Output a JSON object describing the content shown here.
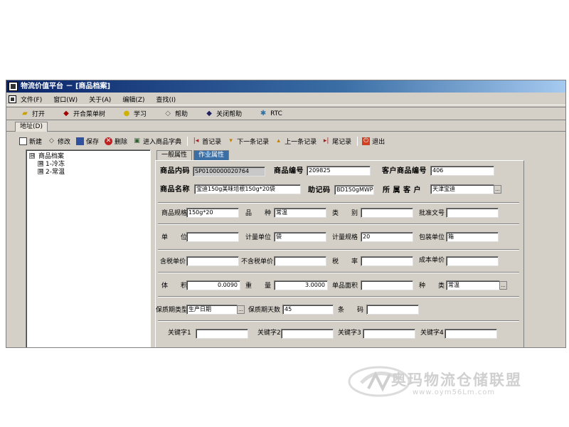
{
  "window": {
    "title": "物流价值平台 － [商品档案]"
  },
  "menu": [
    "文件(F)",
    "窗口(W)",
    "关于(A)",
    "编辑(Z)",
    "查找(I)"
  ],
  "toolbar": [
    {
      "label": "打开",
      "icon": "folder-open-icon"
    },
    {
      "label": "开合菜单树",
      "icon": "car-icon"
    },
    {
      "label": "学习",
      "icon": "bulb-icon"
    },
    {
      "label": "帮助",
      "icon": "diamond-icon"
    },
    {
      "label": "关闭帮助",
      "icon": "diamond-dark-icon"
    },
    {
      "label": "RTC",
      "icon": "gear-icon"
    }
  ],
  "address": {
    "label": "地址(D)"
  },
  "actions": [
    {
      "label": "新建",
      "icon": "new-doc-icon"
    },
    {
      "label": "修改",
      "icon": "edit-icon"
    },
    {
      "label": "保存",
      "icon": "save-icon"
    },
    {
      "label": "删除",
      "icon": "delete-icon"
    },
    {
      "label": "进入商品字典",
      "icon": "dictionary-icon"
    },
    {
      "label": "首记录",
      "icon": "first-record-icon"
    },
    {
      "label": "下一条记录",
      "icon": "next-record-icon"
    },
    {
      "label": "上一条记录",
      "icon": "prev-record-icon"
    },
    {
      "label": "尾记录",
      "icon": "last-record-icon"
    },
    {
      "label": "退出",
      "icon": "exit-icon"
    }
  ],
  "tree": {
    "root": "商品档案",
    "root_toggle": "⊟",
    "children": [
      {
        "toggle": "⊞",
        "label": "1-冷冻"
      },
      {
        "toggle": "⊞",
        "label": "2-常温"
      }
    ]
  },
  "tabs": [
    "一般属性",
    "作业属性"
  ],
  "form": {
    "code_label": "商品内码",
    "code": "SP0100000020764",
    "number_label": "商品编号",
    "number": "209825",
    "client_no_label": "客户商品编号",
    "client_no": "406",
    "name_label": "商品名称",
    "name": "宝迪150g美味培根150g*20袋",
    "mnemonic_label": "助记码",
    "mnemonic": "BD150gMWPG",
    "client_label": "所 属 客 户",
    "client": "天津宝迪",
    "spec_label": "商品规格",
    "spec": "150g*20",
    "variety_label": "品　　种",
    "variety": "常温",
    "category_label": "类　　别",
    "category": "",
    "approval_label": "批准文号",
    "approval": "",
    "unit_label": "单　　位",
    "unit": "",
    "calc_unit_label": "计量单位",
    "calc_unit": "袋",
    "calc_spec_label": "计量规格",
    "calc_spec": "20",
    "pack_unit_label": "包装单位",
    "pack_unit": "箱",
    "price_tax_label": "含税单价",
    "price_tax": "",
    "price_notax_label": "不含税单价",
    "price_notax": "",
    "tax_rate_label": "税　　率",
    "tax_rate": "",
    "cost_label": "成本单价",
    "cost": "",
    "volume_label": "体　　积",
    "volume": "0.0090",
    "weight_label": "重　　量",
    "weight": "3.0000",
    "area_label": "单品面积",
    "area": "",
    "kind_label": "种　　类",
    "kind": "常温",
    "shelf_type_label": "保质期类型",
    "shelf_type": "生产日期",
    "shelf_days_label": "保质期天数",
    "shelf_days": "45",
    "barcode_label": "条　　码",
    "barcode": "",
    "kw1_label": "关键字1",
    "kw1": "",
    "kw2_label": "关键字2",
    "kw2": "",
    "kw3_label": "关键字3",
    "kw3": "",
    "kw4_label": "关键字4",
    "kw4": "",
    "dropdown_glyph": "..."
  },
  "watermark": {
    "text": "奥玛物流仓储联盟",
    "url": "www.oym56Lm.com"
  }
}
